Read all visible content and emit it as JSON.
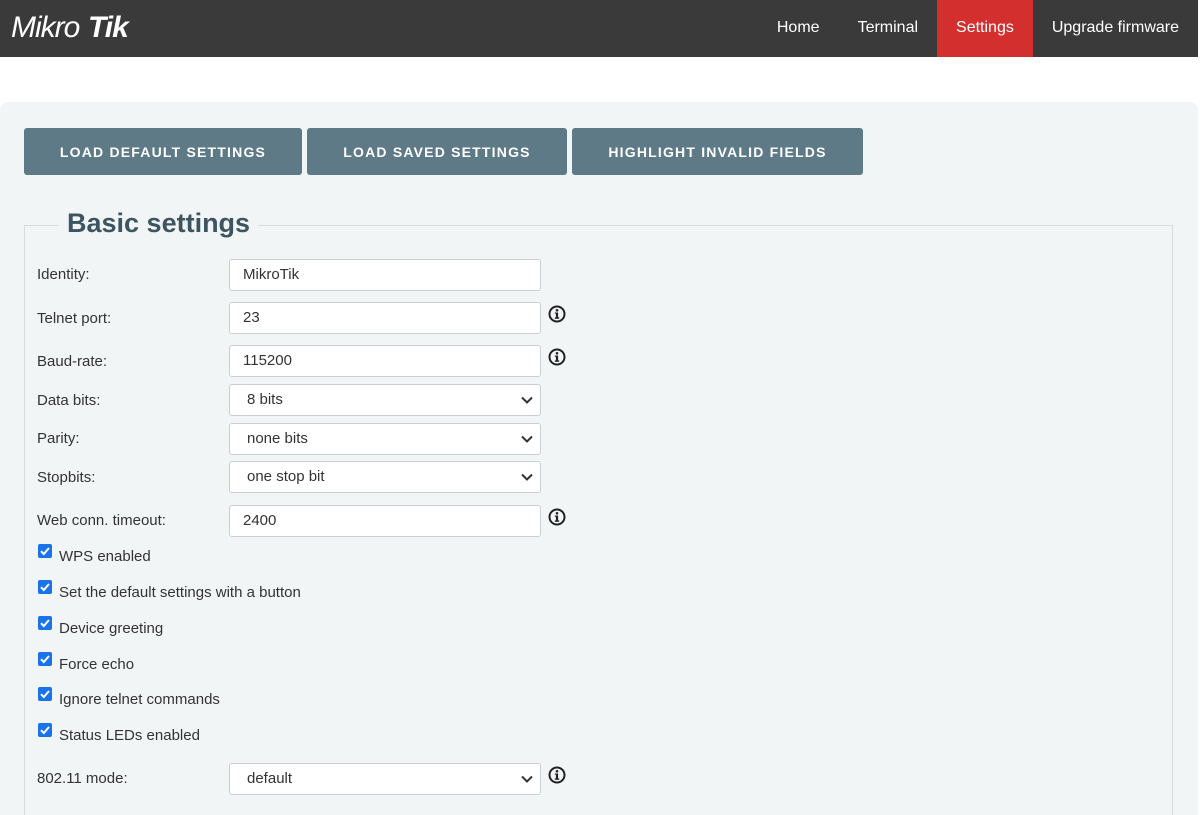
{
  "brand": {
    "logo_text": "MikroTik"
  },
  "nav": [
    {
      "label": "Home"
    },
    {
      "label": "Terminal"
    },
    {
      "label": "Settings",
      "active": true
    },
    {
      "label": "Upgrade firmware"
    }
  ],
  "toolbar": {
    "load_default": "LOAD DEFAULT SETTINGS",
    "load_saved": "LOAD SAVED SETTINGS",
    "highlight_invalid": "HIGHLIGHT INVALID FIELDS"
  },
  "section": {
    "title": "Basic settings"
  },
  "fields": {
    "identity": {
      "label": "Identity:",
      "value": "MikroTik"
    },
    "telnet_port": {
      "label": "Telnet port:",
      "value": "23"
    },
    "baud_rate": {
      "label": "Baud-rate:",
      "value": "115200"
    },
    "data_bits": {
      "label": "Data bits:",
      "value": "8 bits"
    },
    "parity": {
      "label": "Parity:",
      "value": "none bits"
    },
    "stopbits": {
      "label": "Stopbits:",
      "value": "one stop bit"
    },
    "web_timeout": {
      "label": "Web conn. timeout:",
      "value": "2400"
    },
    "mode_80211": {
      "label": "802.11 mode:",
      "value": "default"
    }
  },
  "checkboxes": [
    {
      "label": "WPS enabled",
      "checked": true
    },
    {
      "label": "Set the default settings with a button",
      "checked": true
    },
    {
      "label": "Device greeting",
      "checked": true
    },
    {
      "label": "Force echo",
      "checked": true
    },
    {
      "label": "Ignore telnet commands",
      "checked": true
    },
    {
      "label": "Status LEDs enabled",
      "checked": true
    }
  ],
  "colors": {
    "topbar": "#3a3a3a",
    "active_tab": "#d32f2f",
    "button": "#5e7a87",
    "checkbox": "#1a73e8",
    "panel": "#f2f5f6"
  }
}
